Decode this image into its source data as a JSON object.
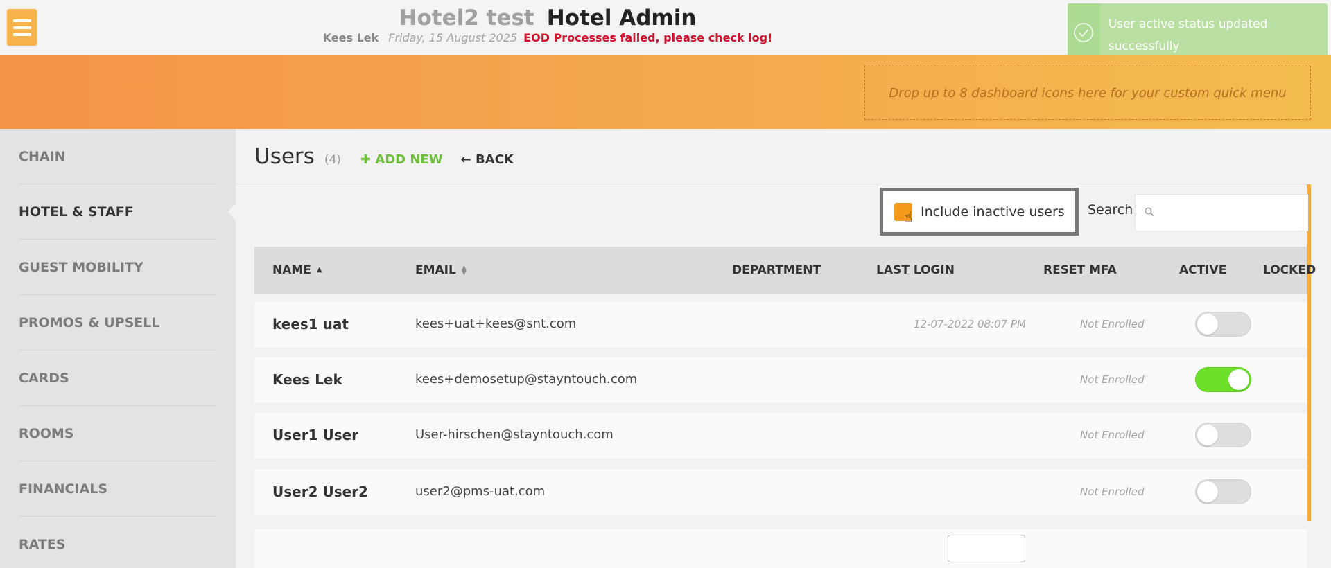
{
  "header": {
    "hotel_name": "Hotel2 test",
    "app_title": "Hotel Admin",
    "user_name": "Kees Lek",
    "date": "Friday, 15 August 2025",
    "error_message": "EOD Processes failed, please check log!"
  },
  "toast": {
    "message": "User active status updated successfully",
    "icon": "check-circle-icon",
    "color": "#b9e0a2"
  },
  "quick_menu": {
    "dropzone_text": "Drop up to 8 dashboard icons here for your custom quick menu"
  },
  "sidebar": {
    "items": [
      {
        "label": "CHAIN"
      },
      {
        "label": "HOTEL & STAFF",
        "active": true
      },
      {
        "label": "GUEST MOBILITY"
      },
      {
        "label": "PROMOS & UPSELL"
      },
      {
        "label": "CARDS"
      },
      {
        "label": "ROOMS"
      },
      {
        "label": "FINANCIALS"
      },
      {
        "label": "RATES"
      }
    ]
  },
  "page": {
    "title": "Users",
    "count": "(4)",
    "add_new_label": "ADD NEW",
    "back_label": "BACK"
  },
  "filters": {
    "include_inactive_label": "Include inactive users",
    "include_inactive_checked": true,
    "search_label": "Search",
    "search_value": ""
  },
  "table": {
    "columns": [
      "NAME",
      "EMAIL",
      "DEPARTMENT",
      "LAST LOGIN",
      "RESET MFA",
      "ACTIVE",
      "LOCKED"
    ],
    "rows": [
      {
        "name": "kees1 uat",
        "email": "kees+uat+kees@snt.com",
        "department": "",
        "last_login": "12-07-2022 08:07 PM",
        "reset_mfa": "Not Enrolled",
        "active": false,
        "locked": ""
      },
      {
        "name": "Kees Lek",
        "email": "kees+demosetup@stayntouch.com",
        "department": "",
        "last_login": "",
        "reset_mfa": "Not Enrolled",
        "active": true,
        "locked": ""
      },
      {
        "name": "User1 User",
        "email": "User-hirschen@stayntouch.com",
        "department": "",
        "last_login": "",
        "reset_mfa": "Not Enrolled",
        "active": false,
        "locked": ""
      },
      {
        "name": "User2 User2",
        "email": "user2@pms-uat.com",
        "department": "",
        "last_login": "",
        "reset_mfa": "Not Enrolled",
        "active": false,
        "locked": ""
      }
    ]
  },
  "colors": {
    "accent_orange": "#f4ae43",
    "add_new_green": "#6fbf3a",
    "toggle_on_green": "#6de12a",
    "error_red": "#d0112b"
  }
}
